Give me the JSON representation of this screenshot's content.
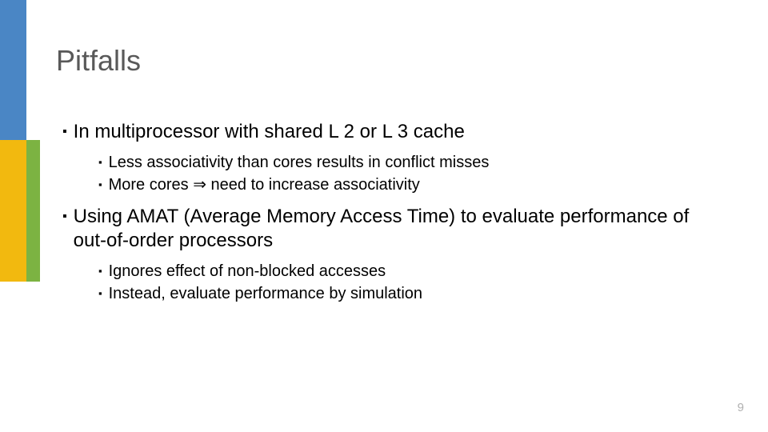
{
  "title": "Pitfalls",
  "items": [
    {
      "text": "In multiprocessor with shared L 2 or L 3 cache",
      "subitems": [
        {
          "text": "Less associativity than cores results in conflict misses"
        },
        {
          "prefix": "More cores ",
          "arrow": "⇒",
          "suffix": " need to increase associativity"
        }
      ]
    },
    {
      "text": "Using AMAT (Average Memory Access Time) to evaluate performance of out-of-order processors",
      "subitems": [
        {
          "text": "Ignores effect of non-blocked accesses"
        },
        {
          "text": "Instead, evaluate performance by simulation"
        }
      ]
    }
  ],
  "page_number": "9"
}
